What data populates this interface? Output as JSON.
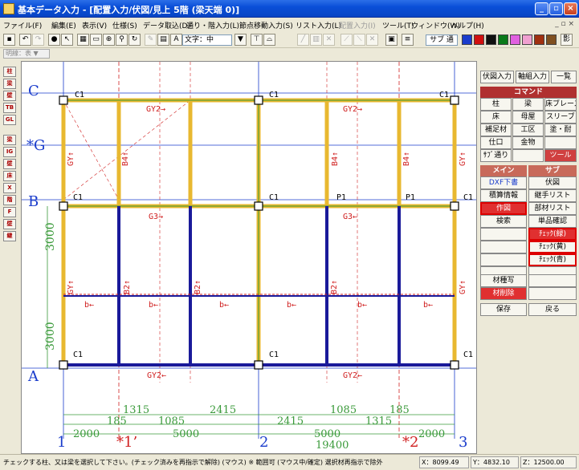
{
  "window": {
    "title": "基本データ入力 - [配置入力/伏図/見上 5階 (梁天端 0)]"
  },
  "menu": [
    {
      "label": "ファイル(F)",
      "enabled": true
    },
    {
      "label": "編集(E)",
      "enabled": true
    },
    {
      "label": "表示(V)",
      "enabled": true
    },
    {
      "label": "仕様(S)",
      "enabled": true
    },
    {
      "label": "データ取込(D)",
      "enabled": true
    },
    {
      "label": "通り・階入力(L)",
      "enabled": true
    },
    {
      "label": "節点移動入力(S)",
      "enabled": true
    },
    {
      "label": "リスト入力(L)",
      "enabled": true
    },
    {
      "label": "配置入力(I)",
      "enabled": false
    },
    {
      "label": "ツール(T)",
      "enabled": true
    },
    {
      "label": "ウィンドウ(W)",
      "enabled": true
    },
    {
      "label": "ヘルプ(H)",
      "enabled": true
    }
  ],
  "mdi_controls": "_ ▫ ×",
  "toolbar": {
    "font_select": "文字：中",
    "hinge_label": "サブ 通",
    "swatches": [
      "#1a3ccc",
      "#d01010",
      "#101010",
      "#0a7a1a",
      "#e060e0",
      "#f0a0d0",
      "#a03010",
      "#805020"
    ],
    "swatch_end_label": "影"
  },
  "subbar": {
    "select": "明線：表 ▼"
  },
  "left_tools": [
    "柱",
    "梁",
    "壁",
    "TB",
    "GL",
    "梁",
    "IG",
    "壁",
    "床",
    "X",
    "階",
    "F",
    "壁",
    "継"
  ],
  "canvas": {
    "axis_rows": [
      "C",
      "*G",
      "B",
      "A"
    ],
    "axis_cols": [
      "1",
      "*1’",
      "2",
      "*2",
      "3"
    ],
    "column_labels": [
      "C1",
      "C1",
      "C1",
      "C1",
      "P1",
      "P1",
      "C1",
      "C1",
      "C1",
      "C1",
      "C1"
    ],
    "beam_labels": [
      "GY2→",
      "GY2→",
      "G3→",
      "G3←",
      "GY2←",
      "GY2←",
      "B4↑",
      "B4↑",
      "B4↑",
      "B2↑",
      "B2↑",
      "B2↑",
      "GY↑",
      "GY↑",
      "GY↑",
      "GY↑",
      "b←",
      "b←",
      "b←",
      "b←",
      "b←",
      "b←"
    ],
    "row_dims": [
      "3000",
      "3000"
    ],
    "dim_row1": [
      "1315",
      "2415",
      "1085",
      "185"
    ],
    "dim_row2": [
      "185",
      "1085",
      "2415",
      "1315"
    ],
    "dim_row3": [
      "2000",
      "5000",
      "5000",
      "2000"
    ],
    "dim_total": "19400"
  },
  "right_panel": {
    "top_tabs": [
      "伏図入力",
      "軸組入力",
      "一覧"
    ],
    "command_header": "コマンド",
    "commands": [
      "柱",
      "梁",
      "床ブレース",
      "床",
      "母屋",
      "スリーブ",
      "補足材",
      "工区",
      "塗・耐",
      "仕口",
      "金物",
      "",
      "ｻﾌﾞ通り",
      "",
      "ツール"
    ],
    "main_header": "メイン",
    "sub_header": "サブ",
    "main_buttons": [
      "DXF下書",
      "積算情報",
      "作図",
      "検索",
      "",
      "",
      "",
      "",
      "材種写",
      "材削除"
    ],
    "sub_buttons": [
      "伏図",
      "継手リスト",
      "部材リスト",
      "単品確認",
      "ﾁｪｯｸ(緑)",
      "ﾁｪｯｸ(黄)",
      "ﾁｪｯｸ(青)",
      "",
      "",
      ""
    ],
    "save": "保存",
    "back": "戻る"
  },
  "status": {
    "message": "チェックする柱、又は梁を選択して下さい。(チェック済みを再指示で解除) (マウス) ※ 範囲可 (マウス中/確定) 選択材再指示で除外",
    "x": "X：8099.49",
    "y": "Y：4832.10",
    "z": "Z：12500.00"
  },
  "colors": {
    "title_blue": "#0a4fd8",
    "beam_yellow": "#e8b830",
    "beam_blue": "#1a1a9a",
    "beam_green": "#3a9a3a",
    "axis_blue": "#1a3ccc",
    "axis_red": "#d02020"
  }
}
